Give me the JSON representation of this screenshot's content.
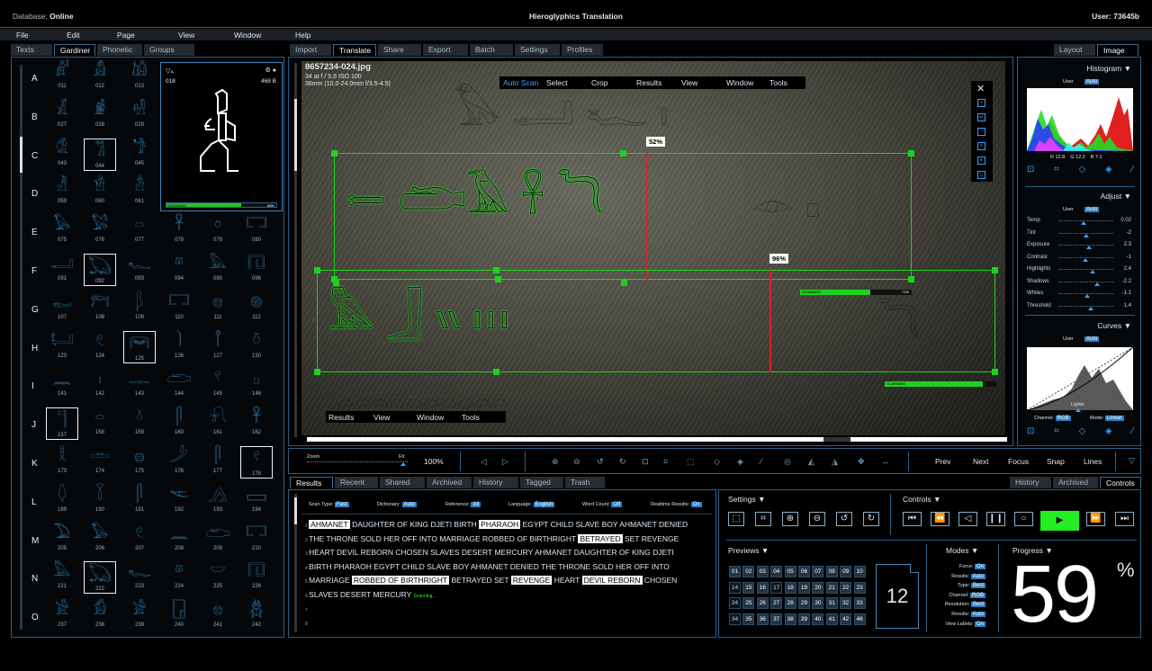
{
  "titlebar": {
    "db_label": "Database:",
    "db_value": "Online",
    "title": "Hieroglyphics Translation",
    "user": "User: 73645b"
  },
  "menu": [
    "File",
    "Edit",
    "Page",
    "View",
    "Window",
    "Help"
  ],
  "left_tabs": [
    "Texts",
    "Gardiner",
    "Phonetic",
    "Groups"
  ],
  "rows": [
    {
      "l": "A",
      "g": [
        {
          "n": "011",
          "s": "𓀊"
        },
        {
          "n": "012",
          "s": "𓀋"
        },
        {
          "n": "013",
          "s": "𓀌"
        }
      ]
    },
    {
      "l": "B",
      "g": [
        {
          "n": "027",
          "s": "𓁕"
        },
        {
          "n": "028",
          "s": "𓁖"
        },
        {
          "n": "029",
          "s": "𓁗"
        }
      ]
    },
    {
      "l": "C",
      "g": [
        {
          "n": "043",
          "s": "𓁘"
        },
        {
          "n": "044",
          "s": "𓀢"
        },
        {
          "n": "045",
          "s": "𓁙"
        }
      ]
    },
    {
      "l": "D",
      "g": [
        {
          "n": "059",
          "s": "𓁚"
        },
        {
          "n": "060",
          "s": "𓁛"
        },
        {
          "n": "061",
          "s": "𓁜"
        }
      ]
    },
    {
      "l": "E",
      "g": [
        {
          "n": "075",
          "s": "𓅃"
        },
        {
          "n": "076",
          "s": "𓅄"
        },
        {
          "n": "077",
          "s": "𓏏"
        },
        {
          "n": "078",
          "s": "𓋹"
        },
        {
          "n": "079",
          "s": "𓏌"
        },
        {
          "n": "080",
          "s": "𓉐"
        }
      ]
    },
    {
      "l": "F",
      "g": [
        {
          "n": "091",
          "s": "𓂝"
        },
        {
          "n": "092",
          "s": "𓆏"
        },
        {
          "n": "093",
          "s": "𓆑"
        },
        {
          "n": "094",
          "s": "𓎼"
        },
        {
          "n": "095",
          "s": "𓅓"
        },
        {
          "n": "096",
          "s": "𓉔"
        }
      ]
    },
    {
      "l": "G",
      "g": [
        {
          "n": "107",
          "s": "𓀿"
        },
        {
          "n": "108",
          "s": "𓁀"
        },
        {
          "n": "109",
          "s": "𓆄"
        },
        {
          "n": "110",
          "s": "𓉐"
        },
        {
          "n": "111",
          "s": "𓊖"
        },
        {
          "n": "112",
          "s": "𓊗"
        }
      ]
    },
    {
      "l": "H",
      "g": [
        {
          "n": "123",
          "s": "𓂡"
        },
        {
          "n": "124",
          "s": "𓏲"
        },
        {
          "n": "125",
          "s": "𓋞"
        },
        {
          "n": "126",
          "s": "𓌙"
        },
        {
          "n": "127",
          "s": "𓋾"
        },
        {
          "n": "130",
          "s": "𓏊"
        }
      ]
    },
    {
      "l": "I",
      "g": [
        {
          "n": "141",
          "s": "𓈖"
        },
        {
          "n": "142",
          "s": "𓏤"
        },
        {
          "n": "143",
          "s": "𓊃"
        },
        {
          "n": "144",
          "s": "𓂧"
        },
        {
          "n": "145",
          "s": "𓍢"
        },
        {
          "n": "146",
          "s": "𓊪"
        }
      ]
    },
    {
      "l": "J",
      "g": [
        {
          "n": "157",
          "s": "𓊹"
        },
        {
          "n": "158",
          "s": "𓏏"
        },
        {
          "n": "159",
          "s": "𓍱"
        },
        {
          "n": "160",
          "s": "𓋴"
        },
        {
          "n": "161",
          "s": "𓍯"
        },
        {
          "n": "162",
          "s": "𓋹"
        }
      ]
    },
    {
      "l": "K",
      "g": [
        {
          "n": "173",
          "s": "𓎛"
        },
        {
          "n": "174",
          "s": "𓏛"
        },
        {
          "n": "175",
          "s": "𓐍"
        },
        {
          "n": "176",
          "s": "𓌳"
        },
        {
          "n": "177",
          "s": "𓋴"
        },
        {
          "n": "178",
          "s": "𓍢"
        }
      ]
    },
    {
      "l": "L",
      "g": [
        {
          "n": "189",
          "s": "𓆭"
        },
        {
          "n": "190",
          "s": "𓇅"
        },
        {
          "n": "191",
          "s": "𓋴"
        },
        {
          "n": "192",
          "s": "𓌻"
        },
        {
          "n": "193",
          "s": "𓂻"
        },
        {
          "n": "194",
          "s": "𓈙"
        }
      ]
    },
    {
      "l": "M",
      "g": [
        {
          "n": "205",
          "s": "𓅐"
        },
        {
          "n": "206",
          "s": "𓅃"
        },
        {
          "n": "207",
          "s": "𓏲"
        },
        {
          "n": "208",
          "s": "𓈖"
        },
        {
          "n": "209",
          "s": "𓂧"
        },
        {
          "n": "210",
          "s": "𓉐"
        }
      ]
    },
    {
      "l": "N",
      "g": [
        {
          "n": "221",
          "s": "𓅓"
        },
        {
          "n": "222",
          "s": "𓆏"
        },
        {
          "n": "223",
          "s": "𓆑"
        },
        {
          "n": "224",
          "s": "𓎼"
        },
        {
          "n": "225",
          "s": "𓎟"
        },
        {
          "n": "226",
          "s": "𓉔"
        }
      ]
    },
    {
      "l": "O",
      "g": [
        {
          "n": "237",
          "s": "𓀀"
        },
        {
          "n": "238",
          "s": "𓀁"
        },
        {
          "n": "239",
          "s": "𓀂"
        },
        {
          "n": "240",
          "s": "𓉗"
        },
        {
          "n": "241",
          "s": "𓊖"
        },
        {
          "n": "242",
          "s": "𓆣"
        }
      ]
    }
  ],
  "preview": {
    "num": "018",
    "size": "468 B",
    "status": "SCANNING",
    "pct": "68%"
  },
  "center_tabs": [
    "Import",
    "Translate",
    "Share",
    "Export",
    "Batch",
    "Settings",
    "Profiles"
  ],
  "image": {
    "filename": "8657234-024.jpg",
    "line2": "34 at f / 5.6 ISO 100",
    "line3": "36mm (10.0-24.0mm f/3.5-4.5)",
    "toolbar": [
      "Auto Scan",
      "Select",
      "Crop",
      "Results",
      "View",
      "Window",
      "Tools"
    ],
    "pct1": "52%",
    "pct2": "96%",
    "scan1": "SCANNING",
    "scan1p": "71%",
    "scan2": "SCANNING",
    "scan2p": "99%",
    "bottom_menu": [
      "Results",
      "View",
      "Window",
      "Tools"
    ]
  },
  "zoom": {
    "label": "Zoom",
    "fit": "Fit",
    "value": "100%"
  },
  "nav": [
    "Prev",
    "Next",
    "Focus",
    "Snap",
    "Lines"
  ],
  "right_tabs": [
    "Layout",
    "Image"
  ],
  "histogram": {
    "title": "Histogram",
    "user": "User",
    "auto": "Auto",
    "r": "R  12.8",
    "g": "G  12.2",
    "b": "B  7.1"
  },
  "adjust": {
    "title": "Adjust",
    "user": "User",
    "auto": "Auto",
    "items": [
      {
        "k": "Temp",
        "v": "0.02",
        "p": 0.45
      },
      {
        "k": "Tint",
        "v": "-2",
        "p": 0.5
      },
      {
        "k": "Exposure",
        "v": "2.3",
        "p": 0.55
      },
      {
        "k": "Contrast",
        "v": "-1",
        "p": 0.48
      },
      {
        "k": "Highlights",
        "v": "2.4",
        "p": 0.62
      },
      {
        "k": "Shadows",
        "v": "-2.2",
        "p": 0.7
      },
      {
        "k": "Whites",
        "v": "-1.1",
        "p": 0.52
      },
      {
        "k": "Threshold",
        "v": "1.4",
        "p": 0.58
      }
    ]
  },
  "curves": {
    "title": "Curves",
    "user": "User",
    "auto": "Auto",
    "lights": "Lights",
    "channel": "Channel:",
    "channel_v": "RGB",
    "mode": "Mode:",
    "mode_v": "Linear"
  },
  "results_tabs": [
    "Results",
    "Recent",
    "Shared",
    "Archived",
    "History",
    "Tagged",
    "Trash"
  ],
  "filters": {
    "scan_type": "Scan Type:",
    "scan_v": "Fast",
    "dict": "Dictionary:",
    "dict_v": "Auto",
    "ref": "Reference:",
    "ref_v": "All",
    "lang": "Language:",
    "lang_v": "English",
    "wc": "Word Count:",
    "wc_v": "Off",
    "rt": "Realtime Results:",
    "rt_v": "On"
  },
  "lines": [
    [
      {
        "t": "AHMANET",
        "h": 1
      },
      {
        "t": " DAUGHTER OF KING DJETI BIRTH "
      },
      {
        "t": "PHARAOH",
        "h": 1
      },
      {
        "t": " EGYPT CHILD SLAVE BOY AHMANET DENIED"
      }
    ],
    [
      {
        "t": "THE THRONE SOLD HER OFF INTO MARRIAGE ROBBED OF BIRTHRIGHT "
      },
      {
        "t": "BETRAYED",
        "h": 1
      },
      {
        "t": " SET REVENGE"
      }
    ],
    [
      {
        "t": "HEART DEVIL REBORN CHOSEN SLAVES DESERT MERCURY AHMANET DAUGHTER OF KING DJETI"
      }
    ],
    [
      {
        "t": "BIRTH PHARAOH EGYPT CHILD SLAVE BOY AHMANET DENIED THE THRONE SOLD HER OFF INTO"
      }
    ],
    [
      {
        "t": "MARRIAGE "
      },
      {
        "t": "ROBBED OF BIRTHRIGHT",
        "h": 1
      },
      {
        "t": " BETRAYED SET "
      },
      {
        "t": "REVENGE",
        "h": 1
      },
      {
        "t": " HEART "
      },
      {
        "t": "DEVIL REBORN",
        "h": 1
      },
      {
        "t": " CHOSEN"
      }
    ],
    [
      {
        "t": "SLAVES DESERT MERCURY "
      },
      {
        "t": "Scanning...",
        "g": 1
      }
    ],
    [],
    []
  ],
  "br_tabs": [
    "History",
    "Archived",
    "Controls"
  ],
  "settings_title": "Settings",
  "controls_title": "Controls",
  "previews_title": "Previews",
  "modes_title": "Modes",
  "progress_title": "Progress",
  "chips": [
    "01",
    "02",
    "03",
    "04",
    "05",
    "06",
    "07",
    "08",
    "09",
    "10",
    "14",
    "15",
    "16",
    "17",
    "18",
    "19",
    "20",
    "21",
    "22",
    "23",
    "24",
    "25",
    "26",
    "27",
    "28",
    "29",
    "30",
    "31",
    "32",
    "33",
    "34",
    "35",
    "36",
    "37",
    "38",
    "39",
    "40",
    "41",
    "42",
    "46"
  ],
  "big_num": "12",
  "modes": [
    {
      "k": "Force:",
      "v": "On"
    },
    {
      "k": "Results:",
      "v": "Auto"
    },
    {
      "k": "Type:",
      "v": "Best"
    },
    {
      "k": "Channel:",
      "v": "RGB"
    },
    {
      "k": "Resolution:",
      "v": "Best"
    },
    {
      "k": "Results:",
      "v": "Auto"
    },
    {
      "k": "View Labels:",
      "v": "On"
    }
  ],
  "progress": {
    "value": "59",
    "unit": "%"
  }
}
